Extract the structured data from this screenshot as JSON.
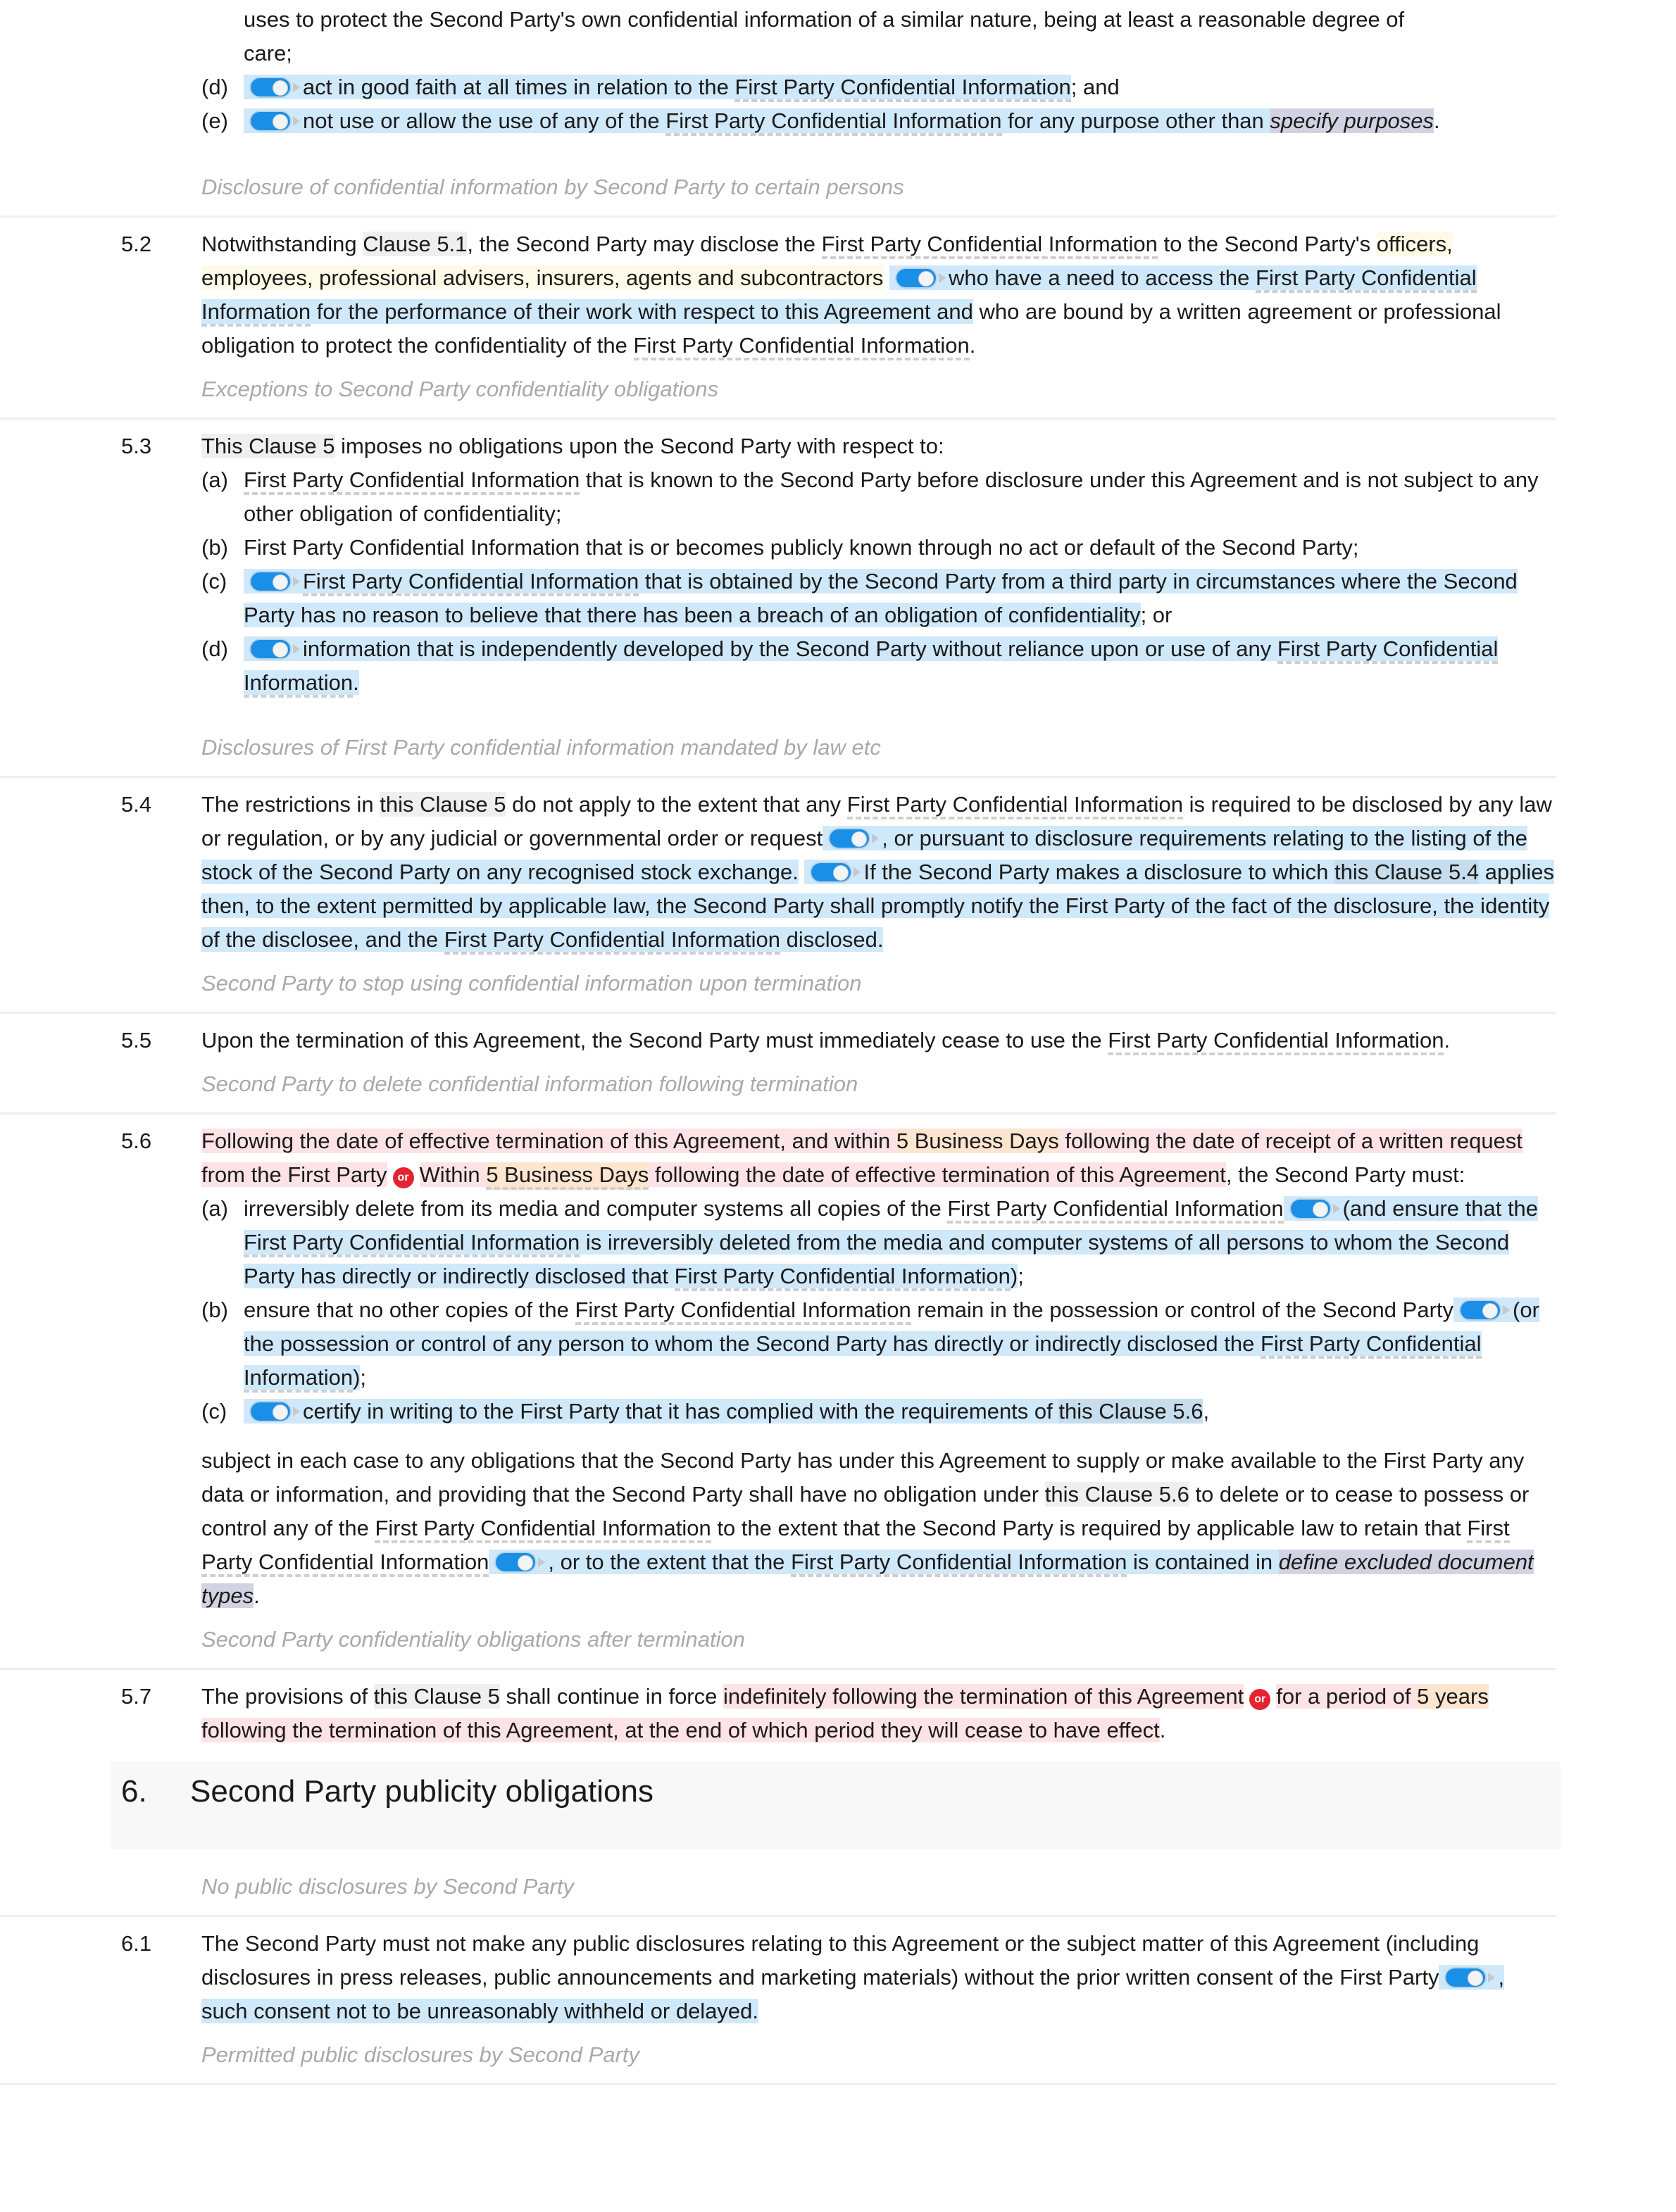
{
  "doc": {
    "toggle_icon": "toggle-on-icon",
    "or_icon": "or-badge-icon",
    "defined_term": "First Party Confidential Information",
    "frag_c": {
      "line1": "uses to protect the Second Party's own confidential information of a similar nature, being at least a reasonable degree of",
      "line2": "care;"
    },
    "frag_d": {
      "letter": "(d)",
      "text": "act in good faith at all times in relation to the",
      "after": "; and"
    },
    "frag_e": {
      "letter": "(e)",
      "pre": "not use or allow the use of any of the",
      "mid": "for any purpose other than",
      "ph": "specify purposes",
      "end": "."
    },
    "h52": "Disclosure of confidential information by Second Party to certain persons",
    "c52": {
      "num": "5.2",
      "t1": "Notwithstanding",
      "ref": "Clause 5.1",
      "t2": ", the Second Party may disclose the",
      "t3": "to the Second Party's",
      "yellow": "officers, employees, professional advisers, insurers, agents and subcontractors",
      "blue1": "who have a need to access the",
      "blue2": "for the performance of their work with respect to this Agreement and",
      "t4": "who are bound by a written agreement or professional obligation to protect the confidentiality of the",
      "end": "."
    },
    "h53": "Exceptions to Second Party confidentiality obligations",
    "c53": {
      "num": "5.3",
      "ref": "This Clause 5",
      "t1": "imposes no obligations upon the Second Party with respect to:",
      "a": {
        "letter": "(a)",
        "text": "that is known to the Second Party before disclosure under this Agreement and is not subject to any other obligation of confidentiality;"
      },
      "b": {
        "letter": "(b)",
        "text": "First Party Confidential Information that is or becomes publicly known through no act or default of the Second Party;"
      },
      "c": {
        "letter": "(c)",
        "text": "that is obtained by the Second Party from a third party in circumstances where the Second Party has no reason to believe that there has been a breach of an obligation of confidentiality",
        "end": "; or"
      },
      "d": {
        "letter": "(d)",
        "text": "information that is independently developed by the Second Party without reliance upon or use of any",
        "end": "."
      }
    },
    "h54": "Disclosures of First Party confidential information mandated by law etc",
    "c54": {
      "num": "5.4",
      "t1": "The restrictions in",
      "ref": "this Clause 5",
      "t2": "do not apply to the extent that any",
      "t3": "is required to be disclosed by any law or regulation, or by any judicial or governmental order or request",
      "blue1": ", or pursuant to disclosure requirements relating to the listing of the stock of the Second Party on any recognised stock exchange.",
      "blue2a": "If the Second Party makes a disclosure to which",
      "ref2": "this Clause 5.4",
      "blue2b": "applies then, to the extent permitted by applicable law, the Second Party shall promptly notify the First Party of the fact of the disclosure, the identity of the disclosee, and the",
      "blue2c": "disclosed."
    },
    "h55": "Second Party to stop using confidential information upon termination",
    "c55": {
      "num": "5.5",
      "t1": "Upon the termination of this Agreement, the Second Party must immediately cease to use the",
      "end": "."
    },
    "h56": "Second Party to delete confidential information following termination",
    "c56": {
      "num": "5.6",
      "p1a": "Following the date of effective termination of this Agreement, and within",
      "days": "5 Business Days",
      "p1b": "following the date of receipt of a written request from the First Party",
      "p2a": "Within",
      "p2b": "following the date of effective termination of this Agreement",
      "t1": ", the Second Party must:",
      "a": {
        "letter": "(a)",
        "t1": "irreversibly delete from its media and computer systems all copies of the",
        "b1": "(and ensure that the",
        "b2": "is irreversibly deleted from the media and computer systems of all persons to whom the Second Party has directly or indirectly disclosed that",
        "b3": ")",
        "end": ";"
      },
      "b": {
        "letter": "(b)",
        "t1": "ensure that no other copies of the",
        "t2": "remain in the possession or control of the Second Party",
        "b1": "(or the possession or control of any person to whom the Second Party has directly or indirectly disclosed the",
        "b2": ")",
        "end": ";"
      },
      "c": {
        "letter": "(c)",
        "t1": "certify in writing to the First Party that it has complied with the requirements of",
        "ref": "this Clause 5.6",
        "end": ","
      },
      "tail": {
        "t1": "subject in each case to any obligations that the Second Party has under this Agreement to supply or make available to the First Party any data or information, and providing that the Second Party shall have no obligation under",
        "ref": "this Clause 5.6",
        "t2": "to delete or to cease to possess or control any of the",
        "t3": "to the extent that the Second Party is required by applicable law to retain that",
        "b1": ", or to the extent that the",
        "b2": "is contained in",
        "ph": "define excluded document types",
        "end": "."
      }
    },
    "h57": "Second Party confidentiality obligations after termination",
    "c57": {
      "num": "5.7",
      "t1": "The provisions of",
      "ref": "this Clause 5",
      "t2": "shall continue in force",
      "p1": "indefinitely following the termination of this Agreement",
      "p2a": "for a period of",
      "years": "5 years",
      "p2b": "following the termination of this Agreement, at the end of which period they will cease to have effect",
      "end": "."
    },
    "section6": {
      "num": "6.",
      "title": "Second Party publicity obligations"
    },
    "h61": "No public disclosures by Second Party",
    "c61": {
      "num": "6.1",
      "t1": "The Second Party must not make any public disclosures relating to this Agreement or the subject matter of this Agreement (including disclosures in press releases, public announcements and marketing materials) without the prior written consent of the First Party",
      "b1": ", such consent not to be unreasonably withheld or delayed."
    },
    "h62": "Permitted public disclosures by Second Party"
  }
}
